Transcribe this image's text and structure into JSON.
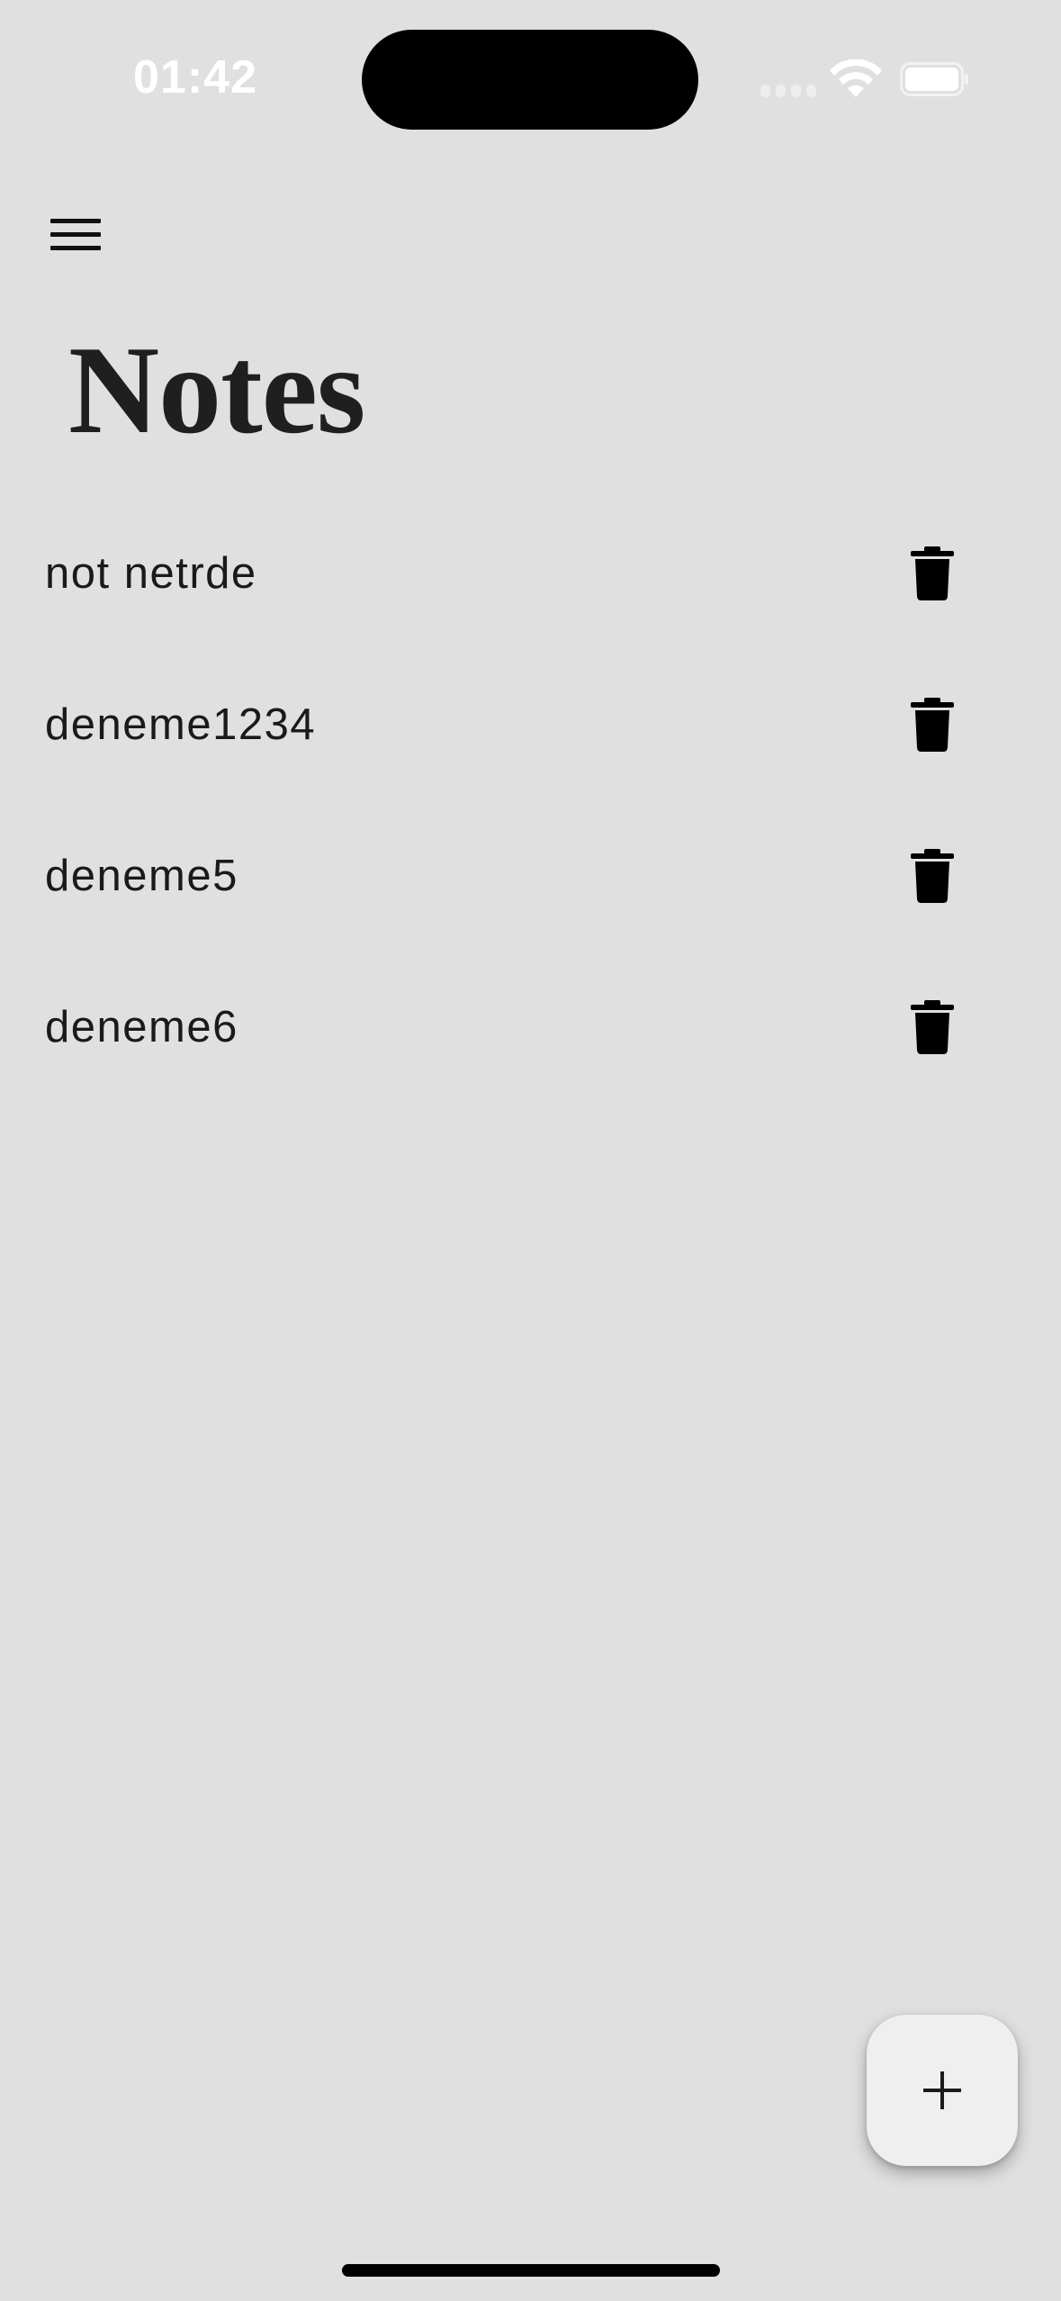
{
  "status_bar": {
    "time": "01:42",
    "icons": [
      "cellular-signal-icon",
      "wifi-icon",
      "battery-icon"
    ]
  },
  "header": {
    "menu_icon": "hamburger-menu-icon",
    "title": "Notes"
  },
  "notes": [
    {
      "title": "not netrde",
      "action_icon": "trash-icon"
    },
    {
      "title": "deneme1234",
      "action_icon": "trash-icon"
    },
    {
      "title": "deneme5",
      "action_icon": "trash-icon"
    },
    {
      "title": "deneme6",
      "action_icon": "trash-icon"
    }
  ],
  "fab": {
    "icon": "plus-icon"
  },
  "colors": {
    "background": "#e0e0e0",
    "text": "#1a1a1a",
    "fab_background": "#efefef"
  }
}
